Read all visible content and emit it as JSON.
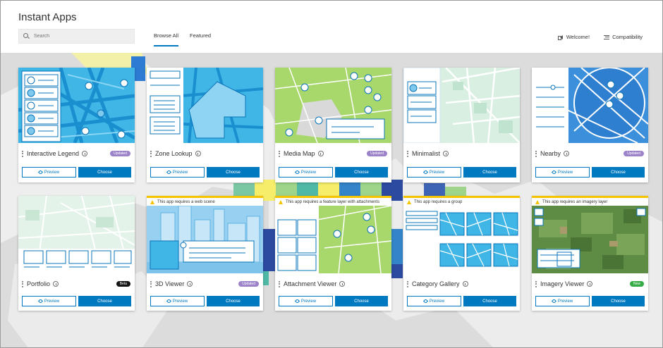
{
  "header": {
    "title": "Instant Apps",
    "search_placeholder": "Search",
    "tabs": [
      {
        "label": "Browse All",
        "active": true
      },
      {
        "label": "Featured",
        "active": false
      }
    ],
    "welcome_label": "Welcome!",
    "compatibility_label": "Compatibility"
  },
  "buttons": {
    "preview": "Preview",
    "choose": "Choose"
  },
  "cards": [
    {
      "title": "Interactive Legend",
      "badge": "Updated",
      "badge_type": "updated",
      "requirement": ""
    },
    {
      "title": "Zone Lookup",
      "badge": "",
      "badge_type": "",
      "requirement": ""
    },
    {
      "title": "Media Map",
      "badge": "Updated",
      "badge_type": "updated",
      "requirement": ""
    },
    {
      "title": "Minimalist",
      "badge": "",
      "badge_type": "",
      "requirement": ""
    },
    {
      "title": "Nearby",
      "badge": "Updated",
      "badge_type": "updated",
      "requirement": ""
    },
    {
      "title": "Portfolio",
      "badge": "Beta",
      "badge_type": "beta",
      "requirement": ""
    },
    {
      "title": "3D Viewer",
      "badge": "Updated",
      "badge_type": "updated",
      "requirement": "This app requires a web scene"
    },
    {
      "title": "Attachment Viewer",
      "badge": "",
      "badge_type": "",
      "requirement": "This app requires a feature layer with attachments"
    },
    {
      "title": "Category Gallery",
      "badge": "",
      "badge_type": "",
      "requirement": "This app requires a group"
    },
    {
      "title": "Imagery Viewer",
      "badge": "New",
      "badge_type": "new",
      "requirement": "This app requires an imagery layer"
    }
  ],
  "colors": {
    "accent": "#0079c1",
    "updated": "#9b82c9",
    "beta": "#151515",
    "new": "#35ac46",
    "warning": "#f4c400"
  }
}
